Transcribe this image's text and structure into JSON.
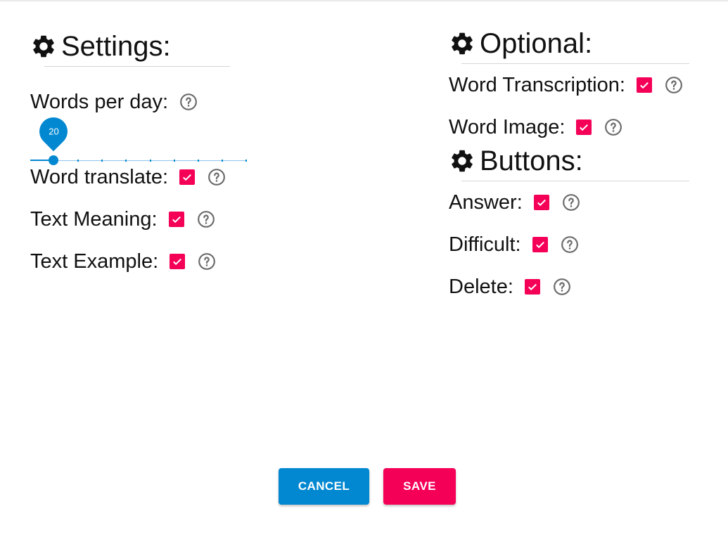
{
  "colors": {
    "accent_primary": "#0288d1",
    "accent_secondary": "#f50057"
  },
  "settings": {
    "title": "Settings:",
    "words_per_day": {
      "label": "Words per day:",
      "value": 20,
      "value_label": "20",
      "fraction": 0.1
    },
    "options": [
      {
        "label": "Word translate:",
        "checked": true
      },
      {
        "label": "Text Meaning:",
        "checked": true
      },
      {
        "label": "Text Example:",
        "checked": true
      }
    ]
  },
  "optional": {
    "title": "Optional:",
    "options": [
      {
        "label": "Word Transcription:",
        "checked": true
      },
      {
        "label": "Word Image:",
        "checked": true
      }
    ]
  },
  "buttons_section": {
    "title": "Buttons:",
    "options": [
      {
        "label": "Answer:",
        "checked": true
      },
      {
        "label": "Difficult:",
        "checked": true
      },
      {
        "label": "Delete:",
        "checked": true
      }
    ]
  },
  "actions": {
    "cancel_label": "CANCEL",
    "save_label": "SAVE"
  }
}
